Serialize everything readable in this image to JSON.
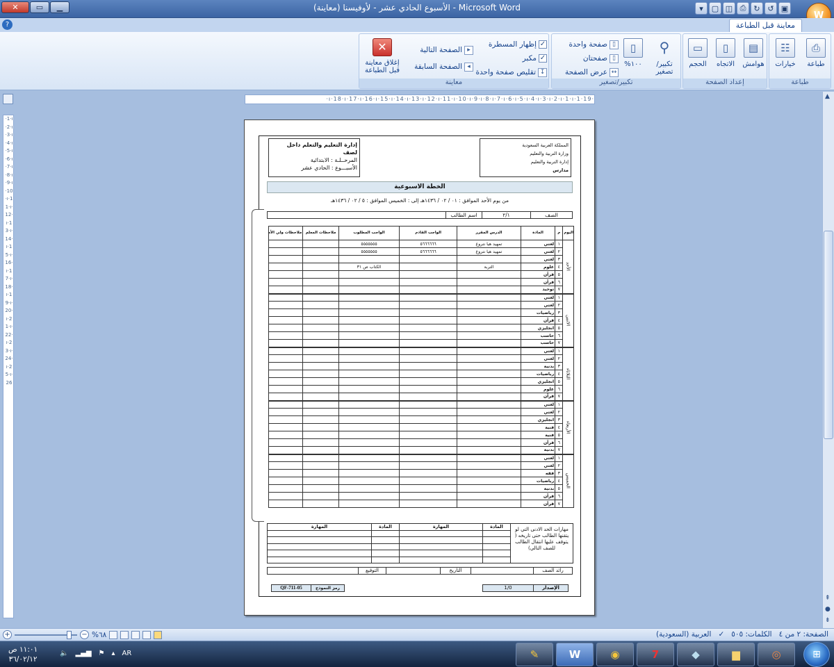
{
  "window": {
    "title": "الأسبوع الحادي عشر - لأوفيسنا (معاينة) - Microsoft Word",
    "office_button": "W"
  },
  "ribbon": {
    "active_tab": "معاينة قبل الطباعة",
    "groups": {
      "print": "طباعة",
      "page_setup": "إعداد الصفحة",
      "zoom": "تكبير/تصغير",
      "preview": "معاينة"
    },
    "print": {
      "print": "طباعة",
      "options": "خيارات"
    },
    "page_setup": {
      "margins": "هوامش",
      "orientation": "الاتجاه",
      "size": "الحجم"
    },
    "zoom": {
      "zoom": "تكبير/تصغير",
      "percent100": "%١٠٠",
      "one_page": "صفحة واحدة",
      "two_pages": "صفحتان",
      "page_width": "عرض الصفحة"
    },
    "preview": {
      "show_ruler": "إظهار المسطرة",
      "magnifier": "مكبر",
      "shrink_one_page": "تقليص صفحة واحدة",
      "next_page": "الصفحة التالية",
      "prev_page": "الصفحة السابقة",
      "close_preview": "إغلاق معاينة قبل الطباعة"
    }
  },
  "ruler": {
    "h": "·19·ı·18·ı·17·ı·16·ı·15·ı·14·ı·13·ı·12·ı·11·ı·10·ı·9·ı·8·ı·7·ı·6·ı·5·ı·4·ı·3·ı·2·ı·1·ı·1·"
  },
  "document": {
    "header_left": [
      "إدارة التعليم والتعلم داخل لصف",
      "المرحــلـة :    الابتدائية",
      "الأسبـــوع :    الحادي عشر"
    ],
    "header_right": [
      "المملكة العربية السعودية",
      "وزارة التربية والتعليم",
      "إدارة التربية والتعليم",
      "مدارس"
    ],
    "plan_title": "الخطة الاسبوعية",
    "date_line": "من يوم الأحد الموافق :   ٠١  /  ٠٢  /   ١٤٣٦هـ    إلى : الخميس  الموافق :   ٥  /  ٠٢  /   ١٤٣٦هـ",
    "class_row": {
      "class_label": "الصف",
      "class_value": "٢/١",
      "student_label": "اسم الطالب"
    },
    "columns": [
      "اليوم",
      "م",
      "المادة",
      "الدرس المقرر",
      "الواجب القادم",
      "الواجب المطلوب",
      "ملاحظات المعلم",
      "ملاحظات ولي الأمر"
    ],
    "days": [
      {
        "name": "الأحد",
        "rows": [
          {
            "n": "١",
            "subject": "لغتي",
            "lesson": "تمهيد هيا نتروع",
            "next": "٥٦٦٦٦٦٦",
            "hw": "٥٥٥٥٥٥٥"
          },
          {
            "n": "٢",
            "subject": "لغتي",
            "lesson": "تمهيد هيا نتروع",
            "next": "٥٦٦٦٦٦٦",
            "hw": "٥٥٥٥٥٥٥"
          },
          {
            "n": "٣",
            "subject": "لغتي",
            "lesson": "",
            "next": "",
            "hw": ""
          },
          {
            "n": "٤",
            "subject": "علوم",
            "lesson": "التربة",
            "next": "",
            "hw": "الكتاب ص ٣١"
          },
          {
            "n": "٥",
            "subject": "قرآن",
            "lesson": "",
            "next": "",
            "hw": ""
          },
          {
            "n": "٦",
            "subject": "قرآن",
            "lesson": "",
            "next": "",
            "hw": ""
          },
          {
            "n": "٧",
            "subject": "توحيد",
            "lesson": "",
            "next": "",
            "hw": ""
          }
        ]
      },
      {
        "name": "الاثنين",
        "rows": [
          {
            "n": "١",
            "subject": "لغتي",
            "lesson": "",
            "next": "",
            "hw": ""
          },
          {
            "n": "٢",
            "subject": "لغتي",
            "lesson": "",
            "next": "",
            "hw": ""
          },
          {
            "n": "٣",
            "subject": "رياضيات",
            "lesson": "",
            "next": "",
            "hw": ""
          },
          {
            "n": "٤",
            "subject": "قرآن",
            "lesson": "",
            "next": "",
            "hw": ""
          },
          {
            "n": "٥",
            "subject": "انجليزي",
            "lesson": "",
            "next": "",
            "hw": ""
          },
          {
            "n": "٦",
            "subject": "حاسب",
            "lesson": "",
            "next": "",
            "hw": ""
          },
          {
            "n": "٧",
            "subject": "حاسب",
            "lesson": "",
            "next": "",
            "hw": ""
          }
        ]
      },
      {
        "name": "الثلاثاء",
        "rows": [
          {
            "n": "١",
            "subject": "لغتي",
            "lesson": "",
            "next": "",
            "hw": ""
          },
          {
            "n": "٢",
            "subject": "لغتي",
            "lesson": "",
            "next": "",
            "hw": ""
          },
          {
            "n": "٣",
            "subject": "بدنية",
            "lesson": "",
            "next": "",
            "hw": ""
          },
          {
            "n": "٤",
            "subject": "رياضيات",
            "lesson": "",
            "next": "",
            "hw": ""
          },
          {
            "n": "٥",
            "subject": "انجليزي",
            "lesson": "",
            "next": "",
            "hw": ""
          },
          {
            "n": "٦",
            "subject": "علوم",
            "lesson": "",
            "next": "",
            "hw": ""
          },
          {
            "n": "٧",
            "subject": "قرآن",
            "lesson": "",
            "next": "",
            "hw": ""
          }
        ]
      },
      {
        "name": "الأربعاء",
        "rows": [
          {
            "n": "١",
            "subject": "لغتي",
            "lesson": "",
            "next": "",
            "hw": ""
          },
          {
            "n": "٢",
            "subject": "لغتي",
            "lesson": "",
            "next": "",
            "hw": ""
          },
          {
            "n": "٣",
            "subject": "انجليزي",
            "lesson": "",
            "next": "",
            "hw": ""
          },
          {
            "n": "٤",
            "subject": "فنية",
            "lesson": "",
            "next": "",
            "hw": ""
          },
          {
            "n": "٥",
            "subject": "فنية",
            "lesson": "",
            "next": "",
            "hw": ""
          },
          {
            "n": "٦",
            "subject": "قرآن",
            "lesson": "",
            "next": "",
            "hw": ""
          },
          {
            "n": "٧",
            "subject": "بدنية",
            "lesson": "",
            "next": "",
            "hw": ""
          }
        ]
      },
      {
        "name": "الخميس",
        "rows": [
          {
            "n": "١",
            "subject": "لغتي",
            "lesson": "",
            "next": "",
            "hw": ""
          },
          {
            "n": "٢",
            "subject": "لغتي",
            "lesson": "",
            "next": "",
            "hw": ""
          },
          {
            "n": "٣",
            "subject": "فقه",
            "lesson": "",
            "next": "",
            "hw": ""
          },
          {
            "n": "٤",
            "subject": "رياضيات",
            "lesson": "",
            "next": "",
            "hw": ""
          },
          {
            "n": "٥",
            "subject": "بدنية",
            "lesson": "",
            "next": "",
            "hw": ""
          },
          {
            "n": "٦",
            "subject": "قرآن",
            "lesson": "",
            "next": "",
            "hw": ""
          },
          {
            "n": "٧",
            "subject": "قرآن",
            "lesson": "",
            "next": "",
            "hw": ""
          }
        ]
      }
    ],
    "skills": {
      "note": "مهارات الحد الادنى التي لو يتقنها الطالب حتى تاريخه ( يتوقف عليها انتقال الطالب للصف التالي)",
      "subject": "المادة",
      "skill": "المهارة"
    },
    "sign_row": {
      "leader": "رائد الصف",
      "date": "التاريخ",
      "signature": "التوقيع"
    },
    "footer": {
      "version_label": "الإصدار",
      "version": "1/0",
      "form_code_label": "رمز النموذج",
      "form_code": "QF-711-05"
    }
  },
  "status": {
    "page": "الصفحة: ٢ من ٤",
    "words": "الكلمات: ٥٠٥",
    "language": "العربية (السعودية)",
    "zoom": "%٦٨"
  },
  "taskbar": {
    "time": "١١:٠١ ص",
    "date": "٣٦/٠٢/١٢",
    "lang": "AR"
  }
}
